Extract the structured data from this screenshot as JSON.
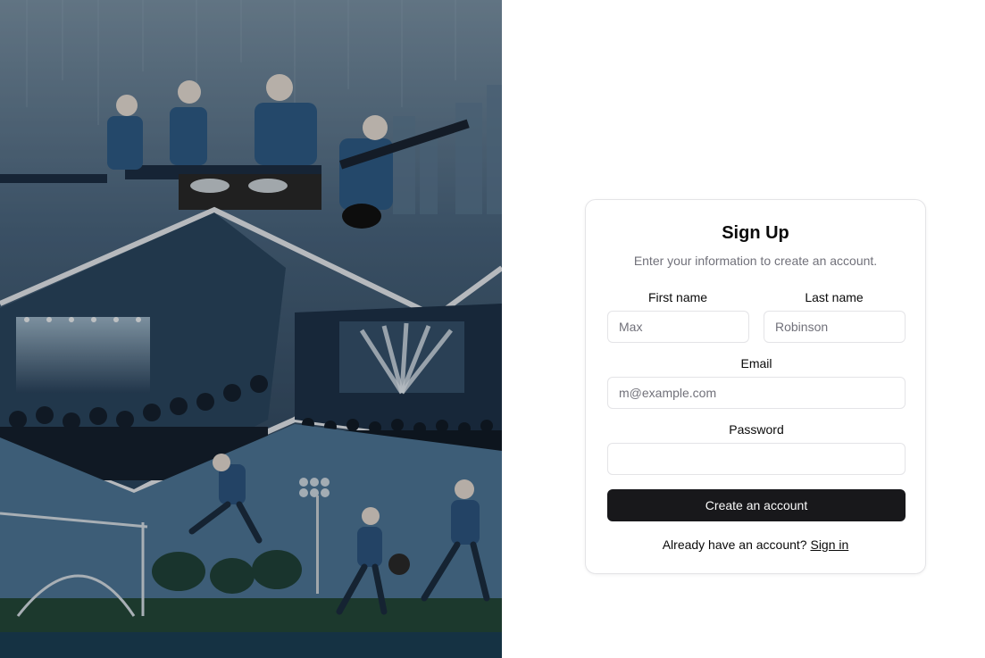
{
  "hero": {
    "icon": "festival-collage-illustration"
  },
  "signup": {
    "title": "Sign Up",
    "subtitle": "Enter your information to create an account.",
    "first_name": {
      "label": "First name",
      "placeholder": "Max",
      "value": ""
    },
    "last_name": {
      "label": "Last name",
      "placeholder": "Robinson",
      "value": ""
    },
    "email": {
      "label": "Email",
      "placeholder": "m@example.com",
      "value": ""
    },
    "password": {
      "label": "Password",
      "placeholder": "",
      "value": ""
    },
    "submit_label": "Create an account",
    "footer_text": "Already have an account?",
    "signin_link": "Sign in"
  },
  "colors": {
    "button_bg": "#18181b",
    "button_text": "#fafafa",
    "muted_text": "#71717a",
    "border": "#e4e4e7"
  }
}
